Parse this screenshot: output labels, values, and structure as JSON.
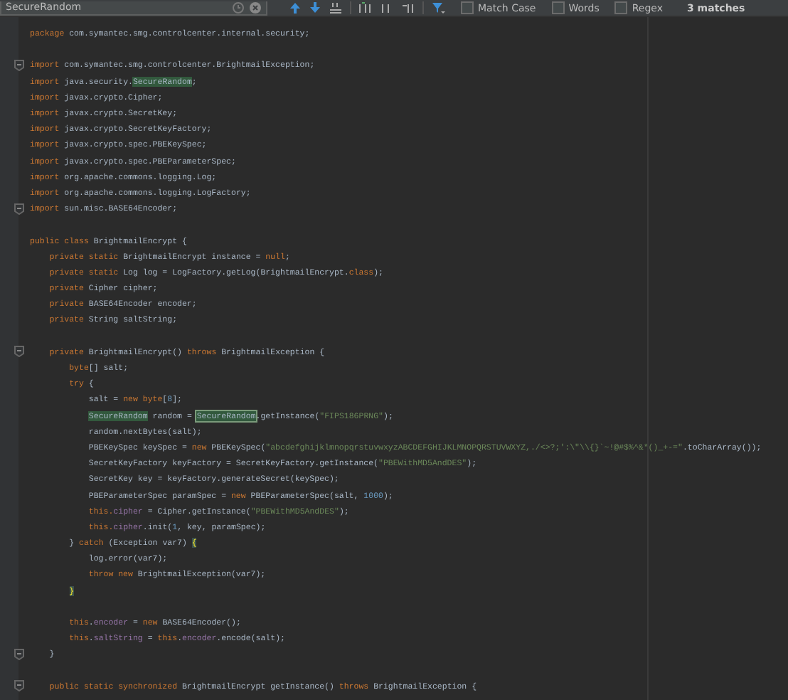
{
  "find_bar": {
    "search_value": "SecureRandom",
    "options": [
      {
        "label": "Match Case",
        "checked": false
      },
      {
        "label": "Words",
        "checked": false
      },
      {
        "label": "Regex",
        "checked": false
      }
    ],
    "match_count": "3 matches"
  },
  "editor": {
    "lines": [
      {
        "kind": "code",
        "fold": false,
        "tokens": [
          {
            "kind": "kw",
            "text": "package"
          },
          {
            "kind": "plain",
            "text": " com.symantec.smg.controlcenter.internal.security;"
          }
        ]
      },
      {
        "kind": "blank",
        "fold": false
      },
      {
        "kind": "code",
        "fold": true,
        "tokens": [
          {
            "kind": "kw",
            "text": "import"
          },
          {
            "kind": "plain",
            "text": " com.symantec.smg.controlcenter.BrightmailException;"
          }
        ]
      },
      {
        "kind": "code",
        "fold": false,
        "tokens": [
          {
            "kind": "kw",
            "text": "import"
          },
          {
            "kind": "plain",
            "text": " java.security."
          },
          {
            "kind": "match",
            "text": "SecureRandom"
          },
          {
            "kind": "plain",
            "text": ";"
          }
        ]
      },
      {
        "kind": "code",
        "fold": false,
        "tokens": [
          {
            "kind": "kw",
            "text": "import"
          },
          {
            "kind": "plain",
            "text": " javax.crypto.Cipher;"
          }
        ]
      },
      {
        "kind": "code",
        "fold": false,
        "tokens": [
          {
            "kind": "kw",
            "text": "import"
          },
          {
            "kind": "plain",
            "text": " javax.crypto.SecretKey;"
          }
        ]
      },
      {
        "kind": "code",
        "fold": false,
        "tokens": [
          {
            "kind": "kw",
            "text": "import"
          },
          {
            "kind": "plain",
            "text": " javax.crypto.SecretKeyFactory;"
          }
        ]
      },
      {
        "kind": "code",
        "fold": false,
        "tokens": [
          {
            "kind": "kw",
            "text": "import"
          },
          {
            "kind": "plain",
            "text": " javax.crypto.spec.PBEKeySpec;"
          }
        ]
      },
      {
        "kind": "code",
        "fold": false,
        "tokens": [
          {
            "kind": "kw",
            "text": "import"
          },
          {
            "kind": "plain",
            "text": " javax.crypto.spec.PBEParameterSpec;"
          }
        ]
      },
      {
        "kind": "code",
        "fold": false,
        "tokens": [
          {
            "kind": "kw",
            "text": "import"
          },
          {
            "kind": "plain",
            "text": " org.apache.commons.logging.Log;"
          }
        ]
      },
      {
        "kind": "code",
        "fold": false,
        "tokens": [
          {
            "kind": "kw",
            "text": "import"
          },
          {
            "kind": "plain",
            "text": " org.apache.commons.logging.LogFactory;"
          }
        ]
      },
      {
        "kind": "code",
        "fold": true,
        "tokens": [
          {
            "kind": "kw",
            "text": "import"
          },
          {
            "kind": "plain",
            "text": " sun.misc.BASE64Encoder;"
          }
        ]
      },
      {
        "kind": "blank",
        "fold": false
      },
      {
        "kind": "code",
        "fold": false,
        "tokens": [
          {
            "kind": "kw",
            "text": "public class"
          },
          {
            "kind": "plain",
            "text": " BrightmailEncrypt {"
          }
        ]
      },
      {
        "kind": "code",
        "fold": false,
        "tokens": [
          {
            "kind": "kw",
            "text": "    private static"
          },
          {
            "kind": "plain",
            "text": " BrightmailEncrypt instance = "
          },
          {
            "kind": "kw",
            "text": "null"
          },
          {
            "kind": "plain",
            "text": ";"
          }
        ]
      },
      {
        "kind": "code",
        "fold": false,
        "tokens": [
          {
            "kind": "kw",
            "text": "    private static"
          },
          {
            "kind": "plain",
            "text": " Log log = LogFactory.getLog(BrightmailEncrypt."
          },
          {
            "kind": "kw",
            "text": "class"
          },
          {
            "kind": "plain",
            "text": ");"
          }
        ]
      },
      {
        "kind": "code",
        "fold": false,
        "tokens": [
          {
            "kind": "kw",
            "text": "    private"
          },
          {
            "kind": "plain",
            "text": " Cipher cipher;"
          }
        ]
      },
      {
        "kind": "code",
        "fold": false,
        "tokens": [
          {
            "kind": "kw",
            "text": "    private"
          },
          {
            "kind": "plain",
            "text": " BASE64Encoder encoder;"
          }
        ]
      },
      {
        "kind": "code",
        "fold": false,
        "tokens": [
          {
            "kind": "kw",
            "text": "    private"
          },
          {
            "kind": "plain",
            "text": " String saltString;"
          }
        ]
      },
      {
        "kind": "blank",
        "fold": false
      },
      {
        "kind": "code",
        "fold": true,
        "tokens": [
          {
            "kind": "kw",
            "text": "    private"
          },
          {
            "kind": "plain",
            "text": " BrightmailEncrypt() "
          },
          {
            "kind": "kw",
            "text": "throws"
          },
          {
            "kind": "plain",
            "text": " BrightmailException {"
          }
        ]
      },
      {
        "kind": "code",
        "fold": false,
        "tokens": [
          {
            "kind": "kw",
            "text": "        byte"
          },
          {
            "kind": "plain",
            "text": "[] salt;"
          }
        ]
      },
      {
        "kind": "code",
        "fold": false,
        "tokens": [
          {
            "kind": "kw",
            "text": "        try"
          },
          {
            "kind": "plain",
            "text": " {"
          }
        ]
      },
      {
        "kind": "code",
        "fold": false,
        "tokens": [
          {
            "kind": "plain",
            "text": "            salt = "
          },
          {
            "kind": "kw",
            "text": "new byte"
          },
          {
            "kind": "plain",
            "text": "["
          },
          {
            "kind": "num",
            "text": "8"
          },
          {
            "kind": "plain",
            "text": "];"
          }
        ]
      },
      {
        "kind": "code",
        "fold": false,
        "tokens": [
          {
            "kind": "match",
            "text": "            SecureRandom"
          },
          {
            "kind": "plain",
            "text": " random = "
          },
          {
            "kind": "current_match",
            "text": "SecureRandom"
          },
          {
            "kind": "plain",
            "text": ".getInstance("
          },
          {
            "kind": "str",
            "text": "\"FIPS186PRNG\""
          },
          {
            "kind": "plain",
            "text": ");"
          }
        ]
      },
      {
        "kind": "code",
        "fold": false,
        "tokens": [
          {
            "kind": "plain",
            "text": "            random.nextBytes(salt);"
          }
        ]
      },
      {
        "kind": "code",
        "fold": false,
        "tokens": [
          {
            "kind": "plain",
            "text": "            PBEKeySpec keySpec = "
          },
          {
            "kind": "kw",
            "text": "new"
          },
          {
            "kind": "plain",
            "text": " PBEKeySpec("
          },
          {
            "kind": "str",
            "text": "\"abcdefghijklmnopqrstuvwxyzABCDEFGHIJKLMNOPQRSTUVWXYZ,./<>?;':\\\"\\\\{}`~!@#$%^&*()_+-=\""
          },
          {
            "kind": "plain",
            "text": ".toCharArray());"
          }
        ]
      },
      {
        "kind": "code",
        "fold": false,
        "tokens": [
          {
            "kind": "plain",
            "text": "            SecretKeyFactory keyFactory = SecretKeyFactory.getInstance("
          },
          {
            "kind": "str",
            "text": "\"PBEWithMD5AndDES\""
          },
          {
            "kind": "plain",
            "text": ");"
          }
        ]
      },
      {
        "kind": "code",
        "fold": false,
        "tokens": [
          {
            "kind": "plain",
            "text": "            SecretKey key = keyFactory.generateSecret(keySpec);"
          }
        ]
      },
      {
        "kind": "code",
        "fold": false,
        "tokens": [
          {
            "kind": "plain",
            "text": "            PBEParameterSpec paramSpec = "
          },
          {
            "kind": "kw",
            "text": "new"
          },
          {
            "kind": "plain",
            "text": " PBEParameterSpec(salt, "
          },
          {
            "kind": "num",
            "text": "1000"
          },
          {
            "kind": "plain",
            "text": ");"
          }
        ]
      },
      {
        "kind": "code",
        "fold": false,
        "tokens": [
          {
            "kind": "kw",
            "text": "            this."
          },
          {
            "kind": "field",
            "text": "cipher"
          },
          {
            "kind": "plain",
            "text": " = Cipher.getInstance("
          },
          {
            "kind": "str",
            "text": "\"PBEWithMD5AndDES\""
          },
          {
            "kind": "plain",
            "text": ");"
          }
        ]
      },
      {
        "kind": "code",
        "fold": false,
        "tokens": [
          {
            "kind": "kw",
            "text": "            this."
          },
          {
            "kind": "field",
            "text": "cipher"
          },
          {
            "kind": "plain",
            "text": ".init("
          },
          {
            "kind": "num",
            "text": "1"
          },
          {
            "kind": "plain",
            "text": ", key, paramSpec);"
          }
        ]
      },
      {
        "kind": "code",
        "fold": false,
        "tokens": [
          {
            "kind": "plain",
            "text": "        } "
          },
          {
            "kind": "kw",
            "text": "catch"
          },
          {
            "kind": "plain",
            "text": " (Exception var7) "
          },
          {
            "kind": "brace",
            "text": "{"
          }
        ]
      },
      {
        "kind": "code",
        "fold": false,
        "tokens": [
          {
            "kind": "plain",
            "text": "            log.error(var7);"
          }
        ]
      },
      {
        "kind": "code",
        "fold": false,
        "tokens": [
          {
            "kind": "kw",
            "text": "            throw new"
          },
          {
            "kind": "plain",
            "text": " BrightmailException(var7);"
          }
        ]
      },
      {
        "kind": "code",
        "fold": false,
        "tokens": [
          {
            "kind": "brace",
            "text": "        }"
          }
        ]
      },
      {
        "kind": "blank",
        "fold": false
      },
      {
        "kind": "code",
        "fold": false,
        "tokens": [
          {
            "kind": "kw",
            "text": "        this"
          },
          {
            "kind": "plain",
            "text": "."
          },
          {
            "kind": "field",
            "text": "encoder"
          },
          {
            "kind": "plain",
            "text": " = "
          },
          {
            "kind": "kw",
            "text": "new"
          },
          {
            "kind": "plain",
            "text": " BASE64Encoder();"
          }
        ]
      },
      {
        "kind": "code",
        "fold": false,
        "tokens": [
          {
            "kind": "kw",
            "text": "        this"
          },
          {
            "kind": "plain",
            "text": "."
          },
          {
            "kind": "field",
            "text": "saltString"
          },
          {
            "kind": "plain",
            "text": " = "
          },
          {
            "kind": "kw",
            "text": "this"
          },
          {
            "kind": "plain",
            "text": "."
          },
          {
            "kind": "field",
            "text": "encoder"
          },
          {
            "kind": "plain",
            "text": ".encode(salt);"
          }
        ]
      },
      {
        "kind": "code",
        "fold": true,
        "tokens": [
          {
            "kind": "plain",
            "text": "    }"
          }
        ]
      },
      {
        "kind": "blank",
        "fold": false
      },
      {
        "kind": "code",
        "fold": true,
        "tokens": [
          {
            "kind": "kw",
            "text": "    public static synchronized"
          },
          {
            "kind": "plain",
            "text": " BrightmailEncrypt getInstance() "
          },
          {
            "kind": "kw",
            "text": "throws"
          },
          {
            "kind": "plain",
            "text": " BrightmailException {"
          }
        ]
      }
    ]
  }
}
